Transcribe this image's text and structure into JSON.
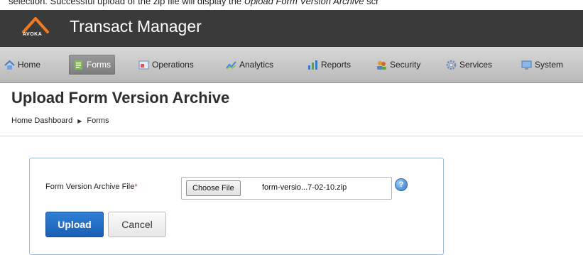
{
  "caption": {
    "text_before": "selection. Successful upload of the zip file will display the ",
    "text_italic": "Upload Form Version Archive",
    "text_after": " scr"
  },
  "app": {
    "logo_text": "AVOKA",
    "title": "Transact Manager"
  },
  "nav": {
    "items": [
      {
        "label": "Home",
        "icon": "home-icon"
      },
      {
        "label": "Forms",
        "icon": "forms-icon"
      },
      {
        "label": "Operations",
        "icon": "operations-icon"
      },
      {
        "label": "Analytics",
        "icon": "analytics-icon"
      },
      {
        "label": "Reports",
        "icon": "reports-icon"
      },
      {
        "label": "Security",
        "icon": "security-icon"
      },
      {
        "label": "Services",
        "icon": "services-icon"
      },
      {
        "label": "System",
        "icon": "system-icon"
      }
    ],
    "active": "Forms"
  },
  "page": {
    "title": "Upload Form Version Archive",
    "breadcrumb": [
      "Home Dashboard",
      "Forms"
    ]
  },
  "form": {
    "field_label": "Form Version Archive File",
    "required_marker": "*",
    "choose_label": "Choose File",
    "file_name": "form-versio...7-02-10.zip",
    "help_glyph": "?",
    "upload_label": "Upload",
    "cancel_label": "Cancel"
  },
  "colors": {
    "appbar": "#3a3a3a",
    "logo_orange": "#f07b20",
    "upload_button": "#1f6cc8",
    "panel_border": "#9db7d4"
  }
}
